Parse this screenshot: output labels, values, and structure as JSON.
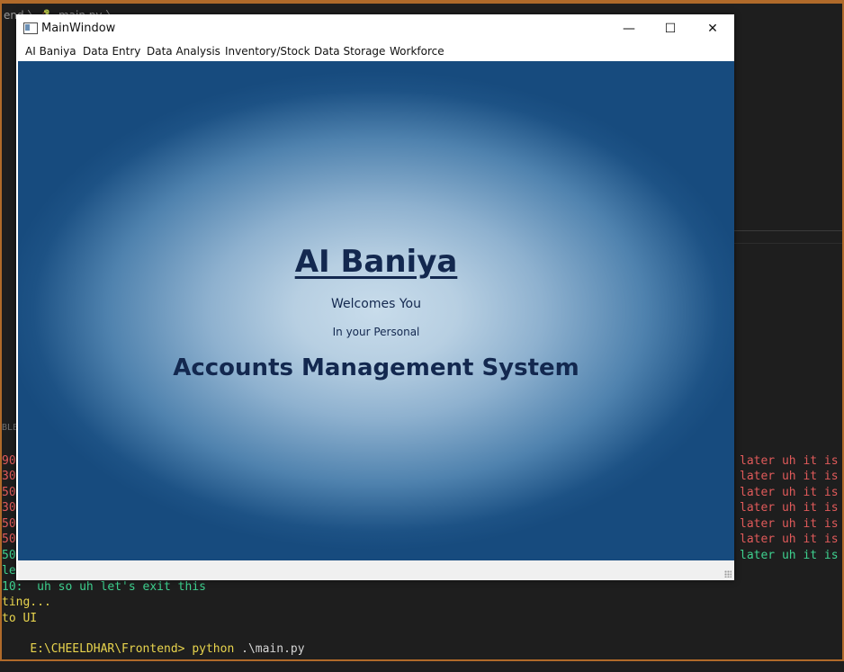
{
  "editor": {
    "breadcrumb": "end 〉 🐍 main.py 〉"
  },
  "terminal": {
    "tab_label": "BLEM",
    "left_prefixes": [
      "90",
      "30",
      "50",
      "30",
      "50",
      "50",
      "50"
    ],
    "right_lines": [
      "later uh it is",
      "later uh it is",
      "later uh it is",
      "later uh it is",
      "later uh it is",
      "later uh it is",
      "later uh it is"
    ],
    "line_le": "le",
    "line_10": "10:  uh so uh let's exit this",
    "line_ting": "ting...",
    "line_toui": "to UI",
    "prompt_path": "E:\\CHEELDHAR\\Frontend>",
    "prompt_cmd": "python",
    "prompt_arg": ".\\main.py"
  },
  "window": {
    "title": "MainWindow",
    "controls": {
      "minimize": "—",
      "maximize": "☐",
      "close": "✕"
    },
    "menu": [
      "AI Baniya",
      "Data Entry",
      "Data Analysis",
      "Inventory/Stock",
      "Data Storage",
      "Workforce"
    ]
  },
  "content": {
    "heading": "AI Baniya",
    "welcome": "Welcomes You",
    "personal": "In your Personal",
    "system": "Accounts Management System"
  }
}
